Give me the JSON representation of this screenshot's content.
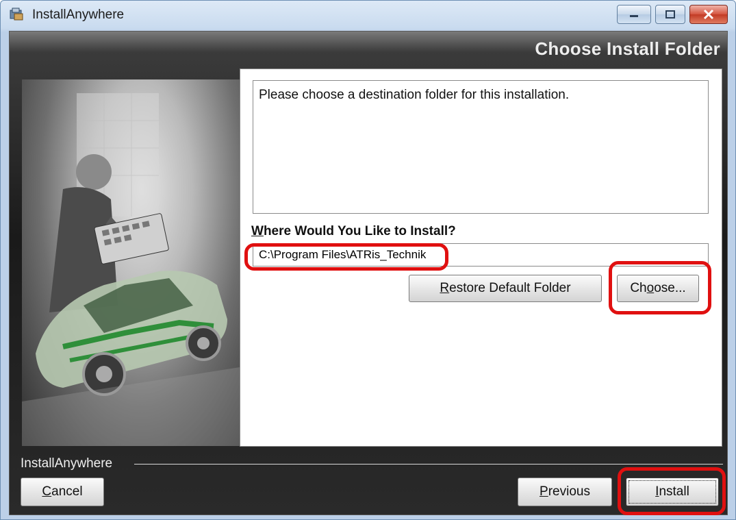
{
  "window": {
    "title": "InstallAnywhere"
  },
  "header": {
    "title": "Choose Install Folder"
  },
  "content": {
    "description": "Please choose a destination folder for this installation.",
    "where_label": "Where Would You Like to Install?",
    "where_mnemonic": "W",
    "where_rest": "here Would You Like to Install?",
    "install_path": "C:\\Program Files\\ATRis_Technik",
    "restore_button": {
      "mnemonic": "R",
      "rest": "estore Default Folder"
    },
    "choose_button": {
      "before": "Ch",
      "mnemonic": "o",
      "after": "ose..."
    }
  },
  "footer": {
    "brand_label": "InstallAnywhere",
    "cancel_button": {
      "mnemonic": "C",
      "rest": "ancel"
    },
    "previous_button": {
      "mnemonic": "P",
      "rest": "revious"
    },
    "install_button": {
      "mnemonic": "I",
      "rest": "nstall"
    }
  },
  "colors": {
    "highlight_annotation": "#e01010"
  }
}
